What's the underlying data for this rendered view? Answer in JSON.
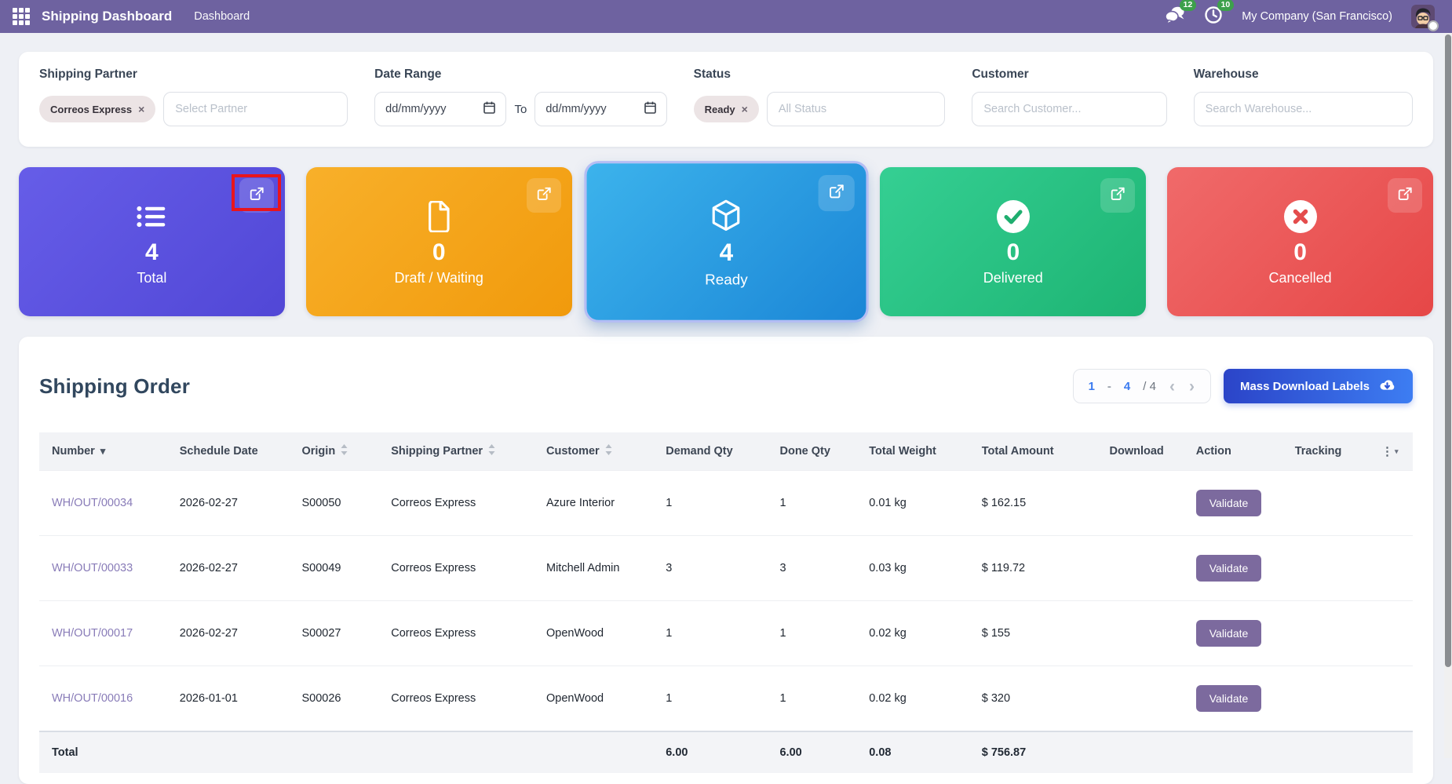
{
  "topbar": {
    "title": "Shipping Dashboard",
    "menu_dashboard": "Dashboard",
    "messages_count": "12",
    "activities_count": "10",
    "company": "My Company (San Francisco)"
  },
  "filters": {
    "shipping_partner": {
      "label": "Shipping Partner",
      "selected_tag": "Correos Express",
      "placeholder": "Select Partner"
    },
    "date_range": {
      "label": "Date Range",
      "from_value": "dd/mm/yyyy",
      "separator": "To",
      "to_value": "dd/mm/yyyy"
    },
    "status": {
      "label": "Status",
      "selected_tag": "Ready",
      "placeholder": "All Status"
    },
    "customer": {
      "label": "Customer",
      "placeholder": "Search Customer..."
    },
    "warehouse": {
      "label": "Warehouse",
      "placeholder": "Search Warehouse..."
    }
  },
  "stat_cards": [
    {
      "id": "total",
      "label": "Total",
      "value": "4",
      "icon": "list-icon",
      "color": "#5b51dd",
      "annotated": true
    },
    {
      "id": "draft_waiting",
      "label": "Draft / Waiting",
      "value": "0",
      "icon": "document-icon",
      "color": "#f5a51c"
    },
    {
      "id": "ready",
      "label": "Ready",
      "value": "4",
      "icon": "cube-icon",
      "color": "#2196dd",
      "selected": true
    },
    {
      "id": "delivered",
      "label": "Delivered",
      "value": "0",
      "icon": "check-circle-icon",
      "color": "#25c183"
    },
    {
      "id": "cancelled",
      "label": "Cancelled",
      "value": "0",
      "icon": "x-circle-icon",
      "color": "#ec5a5b"
    }
  ],
  "annotation": {
    "target": "total-card-open-icon",
    "color": "#e8151d"
  },
  "orders": {
    "title": "Shipping Order",
    "pagination": {
      "range_start": "1",
      "range_separator": "-",
      "range_end": "4",
      "total": "/ 4"
    },
    "mass_download_label": "Mass Download Labels",
    "columns": [
      {
        "label": "Number",
        "sort": "desc"
      },
      {
        "label": "Schedule Date",
        "sort": "none"
      },
      {
        "label": "Origin",
        "sort": "both"
      },
      {
        "label": "Shipping Partner",
        "sort": "both"
      },
      {
        "label": "Customer",
        "sort": "both"
      },
      {
        "label": "Demand Qty",
        "sort": "none"
      },
      {
        "label": "Done Qty",
        "sort": "none"
      },
      {
        "label": "Total Weight",
        "sort": "none"
      },
      {
        "label": "Total Amount",
        "sort": "none"
      },
      {
        "label": "Download",
        "sort": "none"
      },
      {
        "label": "Action",
        "sort": "none"
      },
      {
        "label": "Tracking",
        "sort": "none"
      }
    ],
    "rows": [
      {
        "number": "WH/OUT/00034",
        "schedule_date": "2026-02-27",
        "origin": "S00050",
        "shipping_partner": "Correos Express",
        "customer": "Azure Interior",
        "demand_qty": "1",
        "done_qty": "1",
        "total_weight": "0.01 kg",
        "total_amount": "$ 162.15",
        "download": "",
        "action": "Validate",
        "tracking": ""
      },
      {
        "number": "WH/OUT/00033",
        "schedule_date": "2026-02-27",
        "origin": "S00049",
        "shipping_partner": "Correos Express",
        "customer": "Mitchell Admin",
        "demand_qty": "3",
        "done_qty": "3",
        "total_weight": "0.03 kg",
        "total_amount": "$ 119.72",
        "download": "",
        "action": "Validate",
        "tracking": ""
      },
      {
        "number": "WH/OUT/00017",
        "schedule_date": "2026-02-27",
        "origin": "S00027",
        "shipping_partner": "Correos Express",
        "customer": "OpenWood",
        "demand_qty": "1",
        "done_qty": "1",
        "total_weight": "0.02 kg",
        "total_amount": "$ 155",
        "download": "",
        "action": "Validate",
        "tracking": ""
      },
      {
        "number": "WH/OUT/00016",
        "schedule_date": "2026-01-01",
        "origin": "S00026",
        "shipping_partner": "Correos Express",
        "customer": "OpenWood",
        "demand_qty": "1",
        "done_qty": "1",
        "total_weight": "0.02 kg",
        "total_amount": "$ 320",
        "download": "",
        "action": "Validate",
        "tracking": ""
      }
    ],
    "totals": {
      "label": "Total",
      "demand_qty": "6.00",
      "done_qty": "6.00",
      "total_weight": "0.08",
      "total_amount": "$ 756.87"
    }
  },
  "glyphs": {
    "close": "×",
    "prev": "‹",
    "next": "›",
    "sort_desc": "▾",
    "column_options": "⋮"
  },
  "colors": {
    "topbar_purple": "#6e62a0",
    "badge_green": "#3da04b",
    "card_total": "#5b51dd",
    "card_draft_waiting": "#f5a51c",
    "card_ready": "#2196dd",
    "card_delivered": "#25c183",
    "card_cancelled": "#ec5a5b",
    "annotation_red": "#e8151d",
    "order_link_purple": "#897cb8",
    "validate_purple": "#7c6a9e",
    "primary_blue": "#3b7bf0"
  }
}
